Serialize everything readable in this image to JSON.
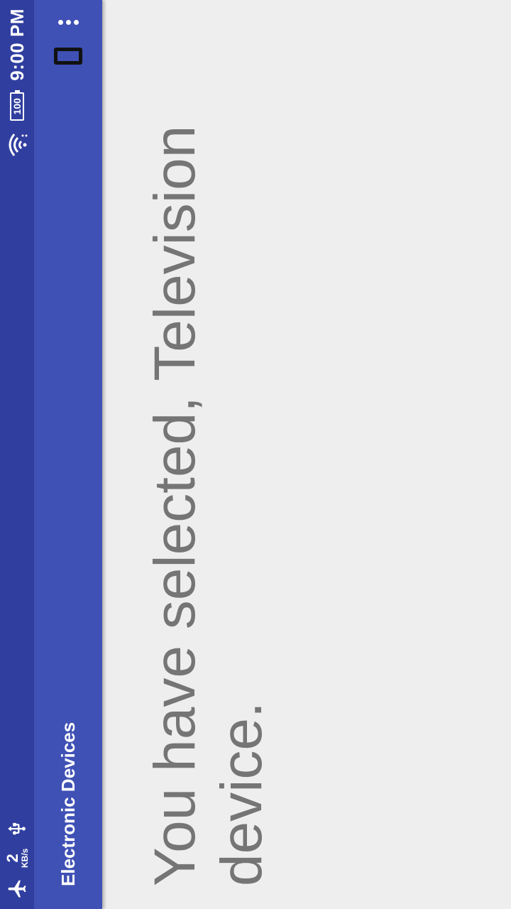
{
  "status_bar": {
    "network_speed_value": "2",
    "network_speed_unit": "KB/s",
    "battery_level": "100",
    "time": "9:00 PM",
    "icons": [
      "airplane-icon",
      "usb-icon",
      "wifi-icon",
      "battery-icon"
    ]
  },
  "toolbar": {
    "title": "Electronic Devices",
    "icons": [
      "screen-rotation-icon",
      "overflow-menu-icon"
    ]
  },
  "main": {
    "message": "You have selected, Television device."
  },
  "colors": {
    "status_bar": "#303f9f",
    "toolbar": "#3f51b5",
    "background": "#eeeeee",
    "message_text": "#757575"
  }
}
